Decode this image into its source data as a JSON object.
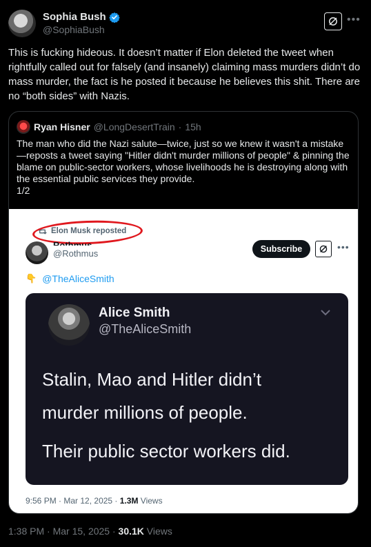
{
  "tweet": {
    "author": {
      "display_name": "Sophia Bush",
      "handle": "@SophiaBush",
      "verified": true
    },
    "text": "This is fucking hideous. It doesn’t matter if Elon deleted the tweet when rightfully called out for falsely (and insanely) claiming mass murders didn’t do mass murder, the fact is he posted it because he believes this shit. There are no “both sides” with Nazis.",
    "time": "1:38 PM",
    "date": "Mar 15, 2025",
    "views_count": "30.1K",
    "views_label": "Views",
    "actions": {
      "grok_icon": "grok-icon",
      "more_icon": "more-icon"
    }
  },
  "quote": {
    "display_name": "Ryan Hisner",
    "handle": "@LongDesertTrain",
    "age": "15h",
    "text": "The man who did the Nazi salute—twice, just so we knew it wasn't a mistake—reposts a tweet saying \"Hitler didn't murder millions of people\" & pinning the blame on public-sector workers, whose livelihoods he is destroying along with the essential public services they provide.\n1/2"
  },
  "screenshot": {
    "repost_label": "Elon Musk reposted",
    "name": "Rothmus",
    "handle": "@Rothmus",
    "subscribe_label": "Subscribe",
    "mention": "@TheAliceSmith",
    "card": {
      "name": "Alice Smith",
      "handle": "@TheAliceSmith",
      "line1": "Stalin, Mao and Hitler didn’t",
      "line2": "murder millions of people.",
      "line3": "Their public sector workers did."
    },
    "time": "9:56 PM",
    "date": "Mar 12, 2025",
    "views_count": "1.3M",
    "views_label": "Views"
  },
  "colors": {
    "accent": "#1d9bf0",
    "annotation_red": "#e0181e",
    "background": "#000000"
  }
}
